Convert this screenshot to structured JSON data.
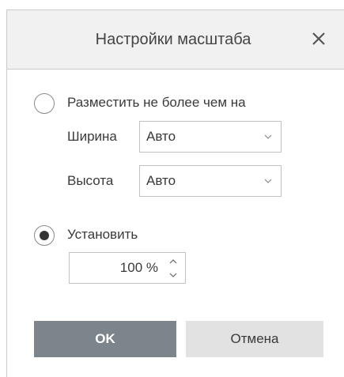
{
  "dialog": {
    "title": "Настройки масштаба",
    "close_icon": "close-icon"
  },
  "fit": {
    "label": "Разместить не более чем на",
    "selected": false,
    "width": {
      "label": "Ширина",
      "value": "Авто"
    },
    "height": {
      "label": "Высота",
      "value": "Авто"
    }
  },
  "set": {
    "label": "Установить",
    "selected": true,
    "scale_value": "100 %"
  },
  "buttons": {
    "ok": "OK",
    "cancel": "Отмена"
  },
  "colors": {
    "ok_bg": "#7d858c",
    "cancel_bg": "#e2e2e2",
    "title_bg": "#f1f1f1"
  }
}
